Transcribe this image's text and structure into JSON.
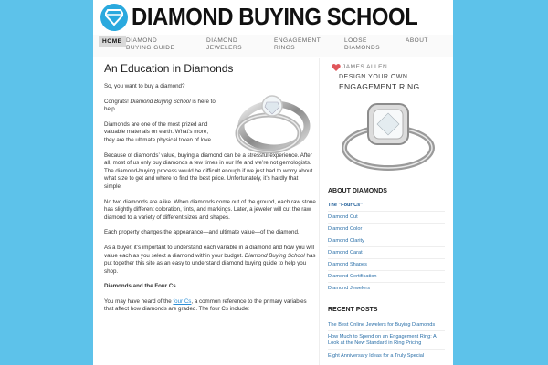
{
  "site": {
    "title": "DIAMOND BUYING SCHOOL"
  },
  "nav": [
    {
      "label": "HOME"
    },
    {
      "label": "DIAMOND BUYING GUIDE"
    },
    {
      "label": "DIAMOND JEWELERS"
    },
    {
      "label": "ENGAGEMENT RINGS"
    },
    {
      "label": "LOOSE DIAMONDS"
    },
    {
      "label": "ABOUT"
    }
  ],
  "post": {
    "title": "An Education in Diamonds",
    "p1": "So, you want to buy a diamond?",
    "p2_a": "Congrats! ",
    "p2_em": "Diamond Buying School",
    "p2_b": " is here to help.",
    "p3": "Diamonds are one of the most prized and valuable materials on earth. What’s more, they are the ultimate physical token of love.",
    "p4": "Because of diamonds’ value, buying a diamond can be a stressful experience. After all, most of us only buy diamonds a few times in our life and we’re not gemologists. The diamond-buying process would be difficult enough if we just had to worry about what size to get and where to find the best price. Unfortunately, it’s hardly that simple.",
    "p5": "No two diamonds are alike. When diamonds come out of the ground, each raw stone has slightly different coloration, tints, and markings. Later, a jeweler will cut the raw diamond to a variety of different sizes and shapes.",
    "p6": "Each property changes the appearance—and ultimate value—of the diamond.",
    "p7_a": "As a buyer, it’s important to understand each variable in a diamond and how you will value each as you select a diamond within your budget. ",
    "p7_em": "Diamond Buying School",
    "p7_b": " has put together this site as an easy to understand diamond buying guide to help you shop.",
    "h2": "Diamonds and the Four Cs",
    "p8_a": "You may have heard of the ",
    "p8_link": "four Cs",
    "p8_b": ", a common reference to the primary variables that affect how diamonds are graded. The four Cs include:"
  },
  "ad": {
    "brand": "JAMES ALLEN",
    "line1": "DESIGN YOUR OWN",
    "line2": "ENGAGEMENT RING"
  },
  "sidebar": {
    "about_heading": "ABOUT DIAMONDS",
    "about_links": [
      "The \"Four Cs\"",
      "Diamond Cut",
      "Diamond Color",
      "Diamond Clarity",
      "Diamond Carat",
      "Diamond Shapes",
      "Diamond Certification",
      "Diamond Jewelers"
    ],
    "recent_heading": "RECENT POSTS",
    "recent_posts": [
      "The Best Online Jewelers for Buying Diamonds",
      "How Much to Spend on an Engagement Ring: A Look at the New Standard in Ring Pricing",
      "Eight Anniversary Ideas for a Truly Special"
    ]
  },
  "colors": {
    "background": "#5dc2ea",
    "logo": "#2aa9de",
    "link": "#2a6fa8"
  }
}
